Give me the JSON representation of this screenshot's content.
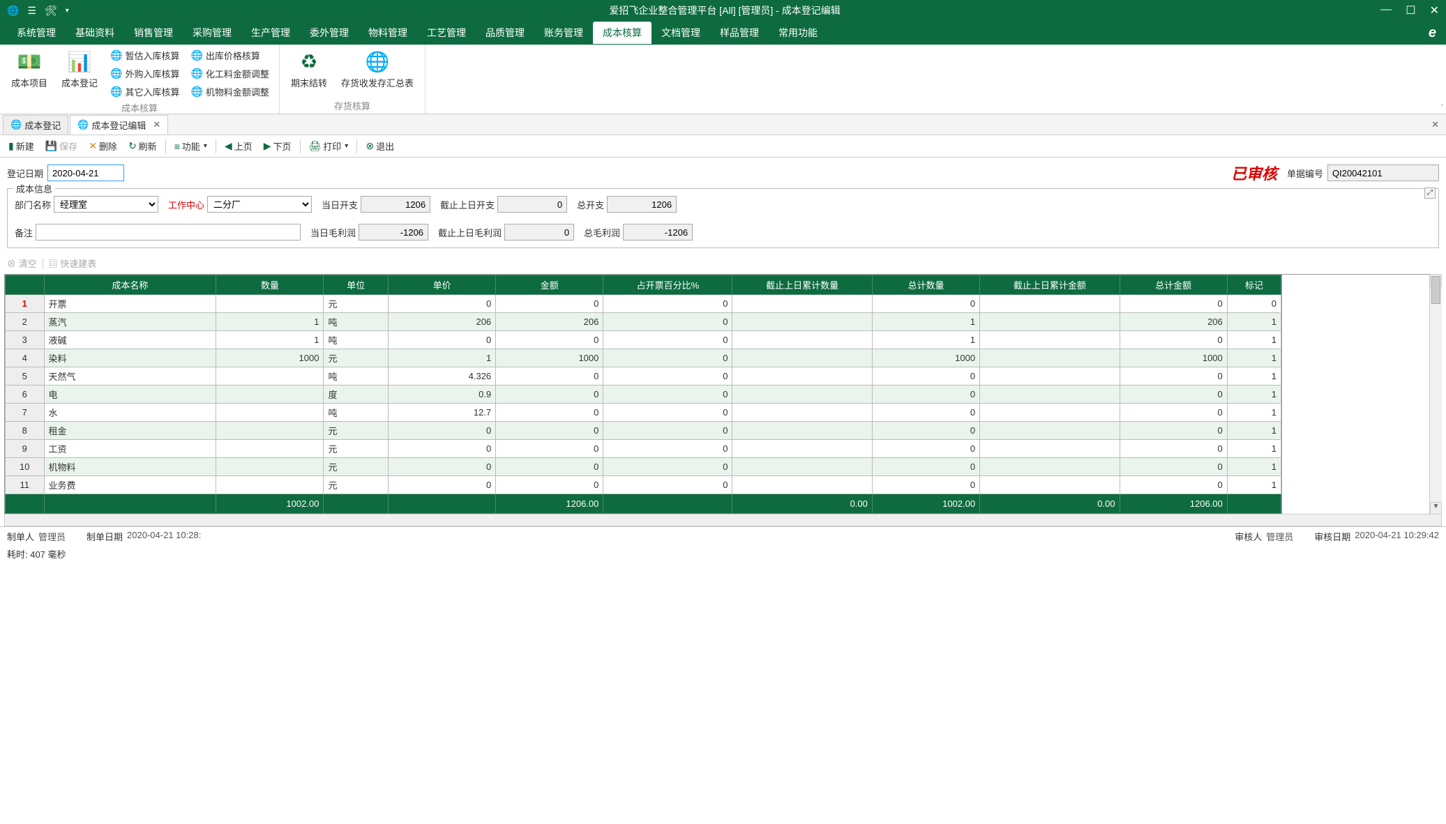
{
  "titlebar": {
    "title": "爱招飞企业整合管理平台 [All] [管理员] - 成本登记编辑"
  },
  "menubar": {
    "items": [
      "系统管理",
      "基础资料",
      "销售管理",
      "采购管理",
      "生产管理",
      "委外管理",
      "物料管理",
      "工艺管理",
      "品质管理",
      "账务管理",
      "成本核算",
      "文档管理",
      "样品管理",
      "常用功能"
    ],
    "active_index": 10
  },
  "ribbon": {
    "group1": {
      "label": "成本核算",
      "btns": [
        {
          "label": "成本项目"
        },
        {
          "label": "成本登记"
        }
      ],
      "small": [
        [
          "暂估入库核算",
          "出库价格核算"
        ],
        [
          "外购入库核算",
          "化工料金额调整"
        ],
        [
          "其它入库核算",
          "机物料金额调整"
        ]
      ]
    },
    "group2": {
      "label": "存货核算",
      "btns": [
        {
          "label": "期末结转"
        },
        {
          "label": "存货收发存汇总表"
        }
      ]
    }
  },
  "tabs": [
    {
      "label": "成本登记",
      "active": false
    },
    {
      "label": "成本登记编辑",
      "active": true,
      "closable": true
    }
  ],
  "toolbar": {
    "new": "新建",
    "save": "保存",
    "delete": "删除",
    "refresh": "刷新",
    "func": "功能",
    "prev": "上页",
    "next": "下页",
    "print": "打印",
    "exit": "退出"
  },
  "header_form": {
    "reg_date_label": "登记日期",
    "reg_date": "2020-04-21",
    "approved_text": "已审核",
    "doc_no_label": "单据编号",
    "doc_no": "QI20042101"
  },
  "cost_info": {
    "legend": "成本信息",
    "dept_label": "部门名称",
    "dept": "经理室",
    "workcenter_label": "工作中心",
    "workcenter": "二分厂",
    "day_expense_label": "当日开支",
    "day_expense": "1206",
    "prev_expense_label": "截止上日开支",
    "prev_expense": "0",
    "total_expense_label": "总开支",
    "total_expense": "1206",
    "remark_label": "备注",
    "remark": "",
    "day_profit_label": "当日毛利润",
    "day_profit": "-1206",
    "prev_profit_label": "截止上日毛利润",
    "prev_profit": "0",
    "total_profit_label": "总毛利润",
    "total_profit": "-1206"
  },
  "subtoolbar": {
    "clear": "清空",
    "quickbuild": "快速建表"
  },
  "grid": {
    "columns": [
      "成本名称",
      "数量",
      "单位",
      "单价",
      "金额",
      "占开票百分比%",
      "截止上日累计数量",
      "总计数量",
      "截止上日累计金额",
      "总计金额",
      "标记"
    ],
    "rows": [
      {
        "n": 1,
        "sel": true,
        "name": "开票",
        "qty": "",
        "unit": "元",
        "price": "0",
        "amount": "0",
        "pct": "0",
        "prevqty": "",
        "totqty": "0",
        "prevamt": "",
        "totamt": "0",
        "flag": "0"
      },
      {
        "n": 2,
        "name": "蒸汽",
        "qty": "1",
        "unit": "吨",
        "price": "206",
        "amount": "206",
        "pct": "0",
        "prevqty": "",
        "totqty": "1",
        "prevamt": "",
        "totamt": "206",
        "flag": "1"
      },
      {
        "n": 3,
        "name": "液碱",
        "qty": "1",
        "unit": "吨",
        "price": "0",
        "amount": "0",
        "pct": "0",
        "prevqty": "",
        "totqty": "1",
        "prevamt": "",
        "totamt": "0",
        "flag": "1"
      },
      {
        "n": 4,
        "name": "染料",
        "qty": "1000",
        "unit": "元",
        "price": "1",
        "amount": "1000",
        "pct": "0",
        "prevqty": "",
        "totqty": "1000",
        "prevamt": "",
        "totamt": "1000",
        "flag": "1"
      },
      {
        "n": 5,
        "name": "天然气",
        "qty": "",
        "unit": "吨",
        "price": "4.326",
        "amount": "0",
        "pct": "0",
        "prevqty": "",
        "totqty": "0",
        "prevamt": "",
        "totamt": "0",
        "flag": "1"
      },
      {
        "n": 6,
        "name": "电",
        "qty": "",
        "unit": "度",
        "price": "0.9",
        "amount": "0",
        "pct": "0",
        "prevqty": "",
        "totqty": "0",
        "prevamt": "",
        "totamt": "0",
        "flag": "1"
      },
      {
        "n": 7,
        "name": "水",
        "qty": "",
        "unit": "吨",
        "price": "12.7",
        "amount": "0",
        "pct": "0",
        "prevqty": "",
        "totqty": "0",
        "prevamt": "",
        "totamt": "0",
        "flag": "1"
      },
      {
        "n": 8,
        "name": "租金",
        "qty": "",
        "unit": "元",
        "price": "0",
        "amount": "0",
        "pct": "0",
        "prevqty": "",
        "totqty": "0",
        "prevamt": "",
        "totamt": "0",
        "flag": "1"
      },
      {
        "n": 9,
        "name": "工资",
        "qty": "",
        "unit": "元",
        "price": "0",
        "amount": "0",
        "pct": "0",
        "prevqty": "",
        "totqty": "0",
        "prevamt": "",
        "totamt": "0",
        "flag": "1"
      },
      {
        "n": 10,
        "name": "机物料",
        "qty": "",
        "unit": "元",
        "price": "0",
        "amount": "0",
        "pct": "0",
        "prevqty": "",
        "totqty": "0",
        "prevamt": "",
        "totamt": "0",
        "flag": "1"
      },
      {
        "n": 11,
        "name": "业务费",
        "qty": "",
        "unit": "元",
        "price": "0",
        "amount": "0",
        "pct": "0",
        "prevqty": "",
        "totqty": "0",
        "prevamt": "",
        "totamt": "0",
        "flag": "1"
      }
    ],
    "footer": {
      "qty": "1002.00",
      "amount": "1206.00",
      "prevqty": "0.00",
      "totqty": "1002.00",
      "prevamt": "0.00",
      "totamt": "1206.00"
    }
  },
  "statusbar": {
    "creator_label": "制单人",
    "creator": "管理员",
    "create_date_label": "制单日期",
    "create_date": "2020-04-21 10:28:",
    "approver_label": "审核人",
    "approver": "管理员",
    "approve_date_label": "审核日期",
    "approve_date": "2020-04-21 10:29:42"
  },
  "timing": "耗时: 407 毫秒"
}
